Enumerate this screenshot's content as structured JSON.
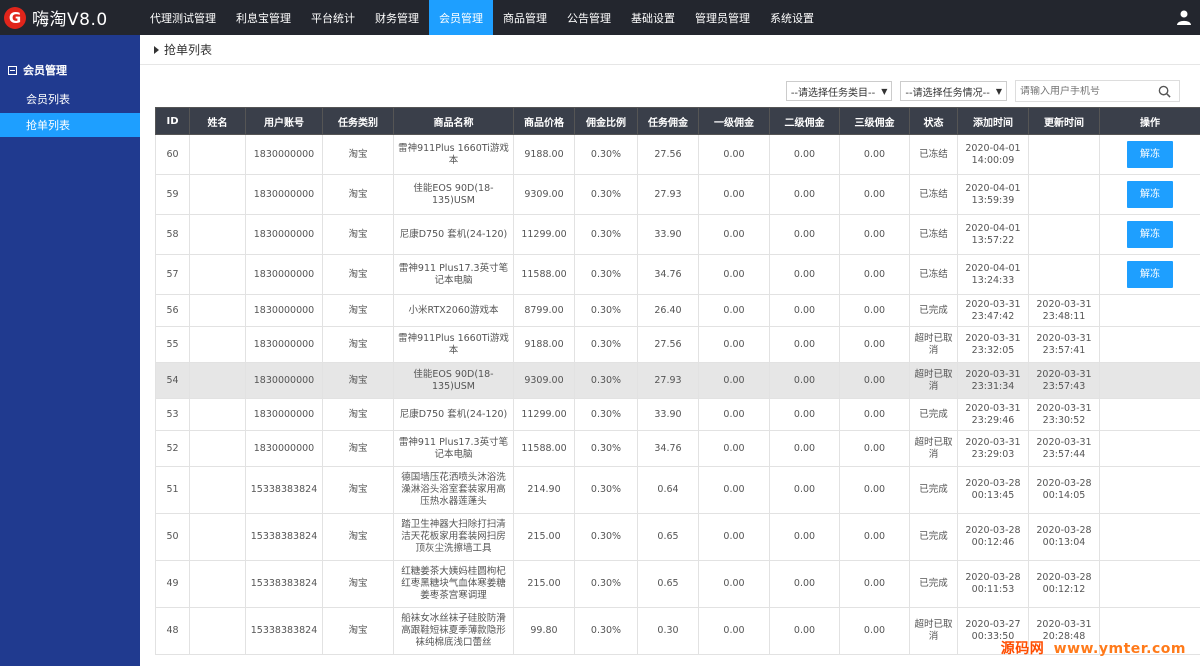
{
  "brand": {
    "logo_letter": "G",
    "title": "嗨淘V8.0"
  },
  "topnav": [
    {
      "label": "代理测试管理",
      "active": false
    },
    {
      "label": "利息宝管理",
      "active": false
    },
    {
      "label": "平台统计",
      "active": false
    },
    {
      "label": "财务管理",
      "active": false
    },
    {
      "label": "会员管理",
      "active": true
    },
    {
      "label": "商品管理",
      "active": false
    },
    {
      "label": "公告管理",
      "active": false
    },
    {
      "label": "基础设置",
      "active": false
    },
    {
      "label": "管理员管理",
      "active": false
    },
    {
      "label": "系统设置",
      "active": false
    }
  ],
  "sidebar": {
    "group": "会员管理",
    "items": [
      {
        "label": "会员列表",
        "active": false
      },
      {
        "label": "抢单列表",
        "active": true
      }
    ]
  },
  "page": {
    "title": "抢单列表"
  },
  "filters": {
    "category_placeholder": "--请选择任务类目--",
    "status_placeholder": "--请选择任务情况--",
    "phone_placeholder": "请输入用户手机号"
  },
  "table": {
    "headers": [
      "ID",
      "姓名",
      "用户账号",
      "任务类别",
      "商品名称",
      "商品价格",
      "佣金比例",
      "任务佣金",
      "一级佣金",
      "二级佣金",
      "三级佣金",
      "状态",
      "添加时间",
      "更新时间",
      "操作"
    ],
    "rows": [
      [
        "60",
        "",
        "1830000000",
        "淘宝",
        "雷神911Plus 1660Ti游戏本",
        "9188.00",
        "0.30%",
        "27.56",
        "0.00",
        "0.00",
        "0.00",
        "已冻结",
        "2020-04-01 14:00:09",
        "",
        "解冻"
      ],
      [
        "59",
        "",
        "1830000000",
        "淘宝",
        "佳能EOS 90D(18-135)USM",
        "9309.00",
        "0.30%",
        "27.93",
        "0.00",
        "0.00",
        "0.00",
        "已冻结",
        "2020-04-01 13:59:39",
        "",
        "解冻"
      ],
      [
        "58",
        "",
        "1830000000",
        "淘宝",
        "尼康D750 套机(24-120)",
        "11299.00",
        "0.30%",
        "33.90",
        "0.00",
        "0.00",
        "0.00",
        "已冻结",
        "2020-04-01 13:57:22",
        "",
        "解冻"
      ],
      [
        "57",
        "",
        "1830000000",
        "淘宝",
        "雷神911 Plus17.3英寸笔记本电脑",
        "11588.00",
        "0.30%",
        "34.76",
        "0.00",
        "0.00",
        "0.00",
        "已冻结",
        "2020-04-01 13:24:33",
        "",
        "解冻"
      ],
      [
        "56",
        "",
        "1830000000",
        "淘宝",
        "小米RTX2060游戏本",
        "8799.00",
        "0.30%",
        "26.40",
        "0.00",
        "0.00",
        "0.00",
        "已完成",
        "2020-03-31 23:47:42",
        "2020-03-31 23:48:11",
        ""
      ],
      [
        "55",
        "",
        "1830000000",
        "淘宝",
        "雷神911Plus 1660Ti游戏本",
        "9188.00",
        "0.30%",
        "27.56",
        "0.00",
        "0.00",
        "0.00",
        "超时已取消",
        "2020-03-31 23:32:05",
        "2020-03-31 23:57:41",
        ""
      ],
      [
        "54",
        "",
        "1830000000",
        "淘宝",
        "佳能EOS 90D(18-135)USM",
        "9309.00",
        "0.30%",
        "27.93",
        "0.00",
        "0.00",
        "0.00",
        "超时已取消",
        "2020-03-31 23:31:34",
        "2020-03-31 23:57:43",
        ""
      ],
      [
        "53",
        "",
        "1830000000",
        "淘宝",
        "尼康D750 套机(24-120)",
        "11299.00",
        "0.30%",
        "33.90",
        "0.00",
        "0.00",
        "0.00",
        "已完成",
        "2020-03-31 23:29:46",
        "2020-03-31 23:30:52",
        ""
      ],
      [
        "52",
        "",
        "1830000000",
        "淘宝",
        "雷神911 Plus17.3英寸笔记本电脑",
        "11588.00",
        "0.30%",
        "34.76",
        "0.00",
        "0.00",
        "0.00",
        "超时已取消",
        "2020-03-31 23:29:03",
        "2020-03-31 23:57:44",
        ""
      ],
      [
        "51",
        "",
        "15338383824",
        "淘宝",
        "德国墙压花洒喷头沐浴洗澡淋浴头浴室套装家用高压热水器莲蓬头",
        "214.90",
        "0.30%",
        "0.64",
        "0.00",
        "0.00",
        "0.00",
        "已完成",
        "2020-03-28 00:13:45",
        "2020-03-28 00:14:05",
        ""
      ],
      [
        "50",
        "",
        "15338383824",
        "淘宝",
        "踏卫生神器大扫除打扫清洁天花板家用套装网扫房顶灰尘洗擦墙工具",
        "215.00",
        "0.30%",
        "0.65",
        "0.00",
        "0.00",
        "0.00",
        "已完成",
        "2020-03-28 00:12:46",
        "2020-03-28 00:13:04",
        ""
      ],
      [
        "49",
        "",
        "15338383824",
        "淘宝",
        "红糖姜茶大姨妈桂圆枸杞红枣黑糖块气血体寒姜糖姜枣茶宫寒调理",
        "215.00",
        "0.30%",
        "0.65",
        "0.00",
        "0.00",
        "0.00",
        "已完成",
        "2020-03-28 00:11:53",
        "2020-03-28 00:12:12",
        ""
      ],
      [
        "48",
        "",
        "15338383824",
        "淘宝",
        "船袜女冰丝袜子硅胶防滑高跟鞋短袜夏季薄款隐形袜纯棉底浅口蕾丝",
        "99.80",
        "0.30%",
        "0.30",
        "0.00",
        "0.00",
        "0.00",
        "超时已取消",
        "2020-03-27 00:33:50",
        "2020-03-31 20:28:48",
        ""
      ]
    ]
  },
  "watermark": {
    "cn": "源码网",
    "url": "www.ymter.com"
  },
  "colors": {
    "topbar": "#23262e",
    "accent": "#1e9fff",
    "sidebar": "#203a8f",
    "header": "#3a3f4a"
  }
}
